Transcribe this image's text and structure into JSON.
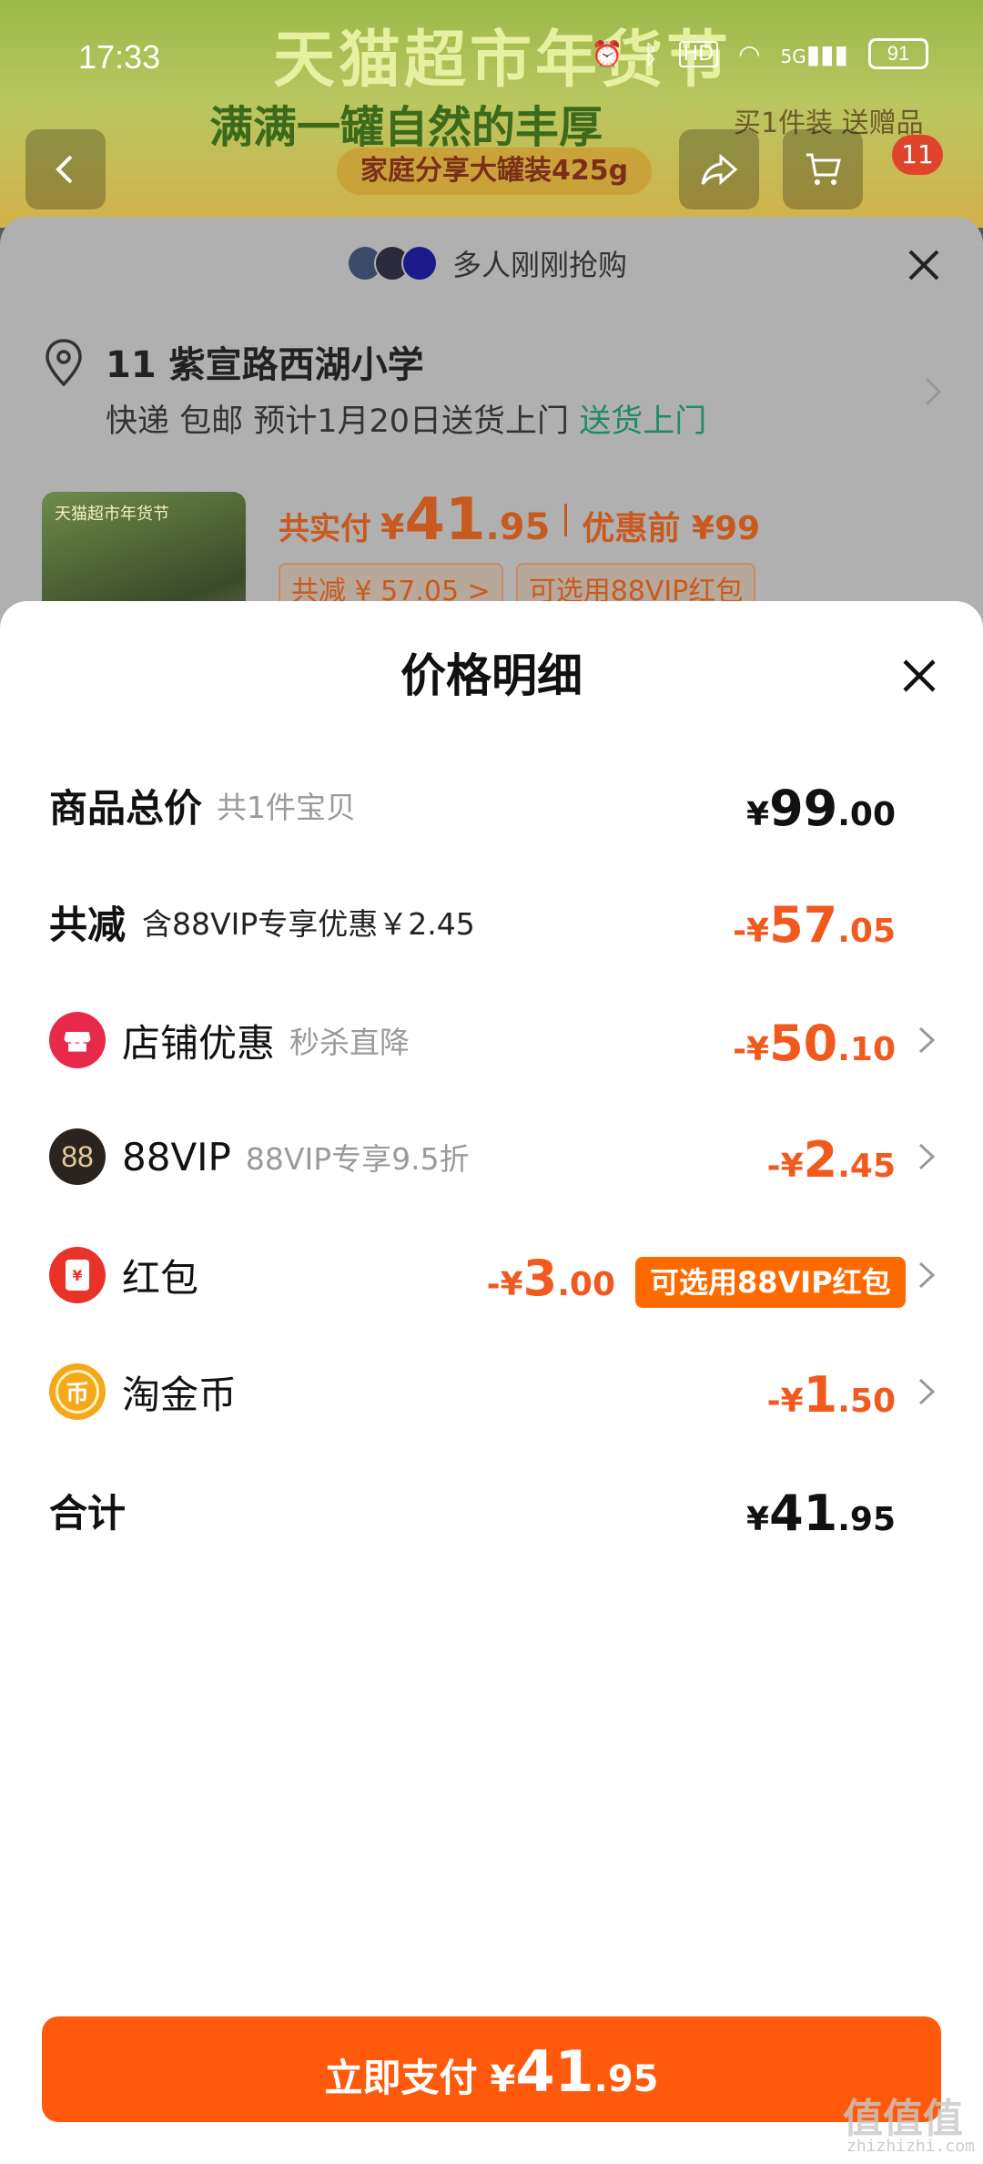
{
  "status_bar": {
    "time": "17:33",
    "network": "5G",
    "hd": "HD",
    "battery": "91"
  },
  "banner": {
    "title": "天猫超市年货节",
    "subtitle": "满满一罐自然的丰厚",
    "pill": "家庭分享大罐装425g",
    "right_text": "买1件装 送赠品",
    "cart_count": "11"
  },
  "order": {
    "buyers_text": "多人刚刚抢购",
    "address": "11 紫宣路西湖小学",
    "delivery": "快递 包邮 预计1月20日送货上门",
    "delivery_highlight": "送货上门",
    "thumb_label": "天猫超市年货节",
    "pay_label": "共实付",
    "pay_yen": "¥",
    "pay_int": "41",
    "pay_dec": ".95",
    "before_label": "优惠前 ¥99",
    "tag_reduce": "共减 ¥ 57.05 >",
    "tag_vip": "可选用88VIP红包"
  },
  "sheet": {
    "title": "价格明细",
    "rows": {
      "total": {
        "title": "商品总价",
        "hint": "共1件宝贝",
        "yen": "¥",
        "int": "99",
        "dec": ".00"
      },
      "reduce": {
        "title": "共减",
        "hint": "含88VIP专享优惠￥2.45",
        "yen": "-¥",
        "int": "57",
        "dec": ".05"
      },
      "shop": {
        "title": "店铺优惠",
        "hint": "秒杀直降",
        "yen": "-¥",
        "int": "50",
        "dec": ".10"
      },
      "vip": {
        "title": "88VIP",
        "hint": "88VIP专享9.5折",
        "icon_text": "88",
        "yen": "-¥",
        "int": "2",
        "dec": ".45"
      },
      "redpacket": {
        "title": "红包",
        "icon_text": "¥",
        "yen": "-¥",
        "int": "3",
        "dec": ".00",
        "pill": "可选用88VIP红包"
      },
      "coin": {
        "title": "淘金币",
        "icon_text": "币",
        "yen": "-¥",
        "int": "1",
        "dec": ".50"
      },
      "sum": {
        "title": "合计",
        "yen": "¥",
        "int": "41",
        "dec": ".95"
      }
    }
  },
  "pay_button": {
    "label": "立即支付",
    "yen": "¥",
    "int": "41",
    "dec": ".95"
  },
  "watermark": {
    "text": "值值值",
    "url": "zhizhizhi.com"
  },
  "colors": {
    "accent": "#ff5a0c",
    "discount": "#f15a1f",
    "shop_icon": "#e8294a",
    "vip_icon": "#2a2420",
    "redpacket_icon": "#e8322a",
    "coin_icon": "#f4a81a"
  },
  "icons": [
    "back-icon",
    "share-icon",
    "cart-icon",
    "close-icon",
    "location-pin-icon",
    "chevron-right-icon",
    "shop-icon",
    "vip-88-icon",
    "red-packet-icon",
    "gold-coin-icon"
  ]
}
